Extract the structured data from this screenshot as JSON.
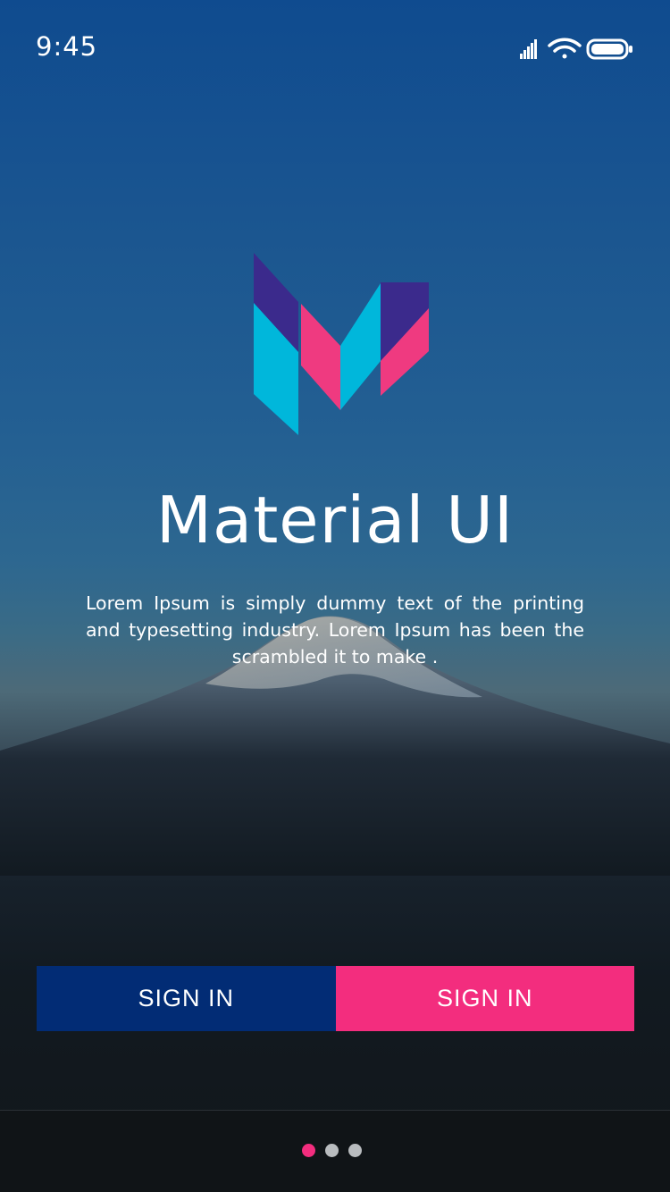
{
  "status_bar": {
    "time": "9:45",
    "icons": [
      "signal-icon",
      "wifi-icon",
      "battery-icon"
    ]
  },
  "hero": {
    "title": "Material UI",
    "description": "Lorem Ipsum is simply dummy text of the printing and typesetting industry. Lorem Ipsum has been the scrambled it to make ."
  },
  "actions": {
    "left_button_label": "SIGN IN",
    "right_button_label": "SIGN IN"
  },
  "pagination": {
    "page_count": 3,
    "active_index": 0
  },
  "colors": {
    "primary": "#022c75",
    "accent": "#f32d7e",
    "logo_purple": "#3b2a8c",
    "logo_cyan": "#00b7db",
    "logo_pink": "#ef3a80"
  }
}
